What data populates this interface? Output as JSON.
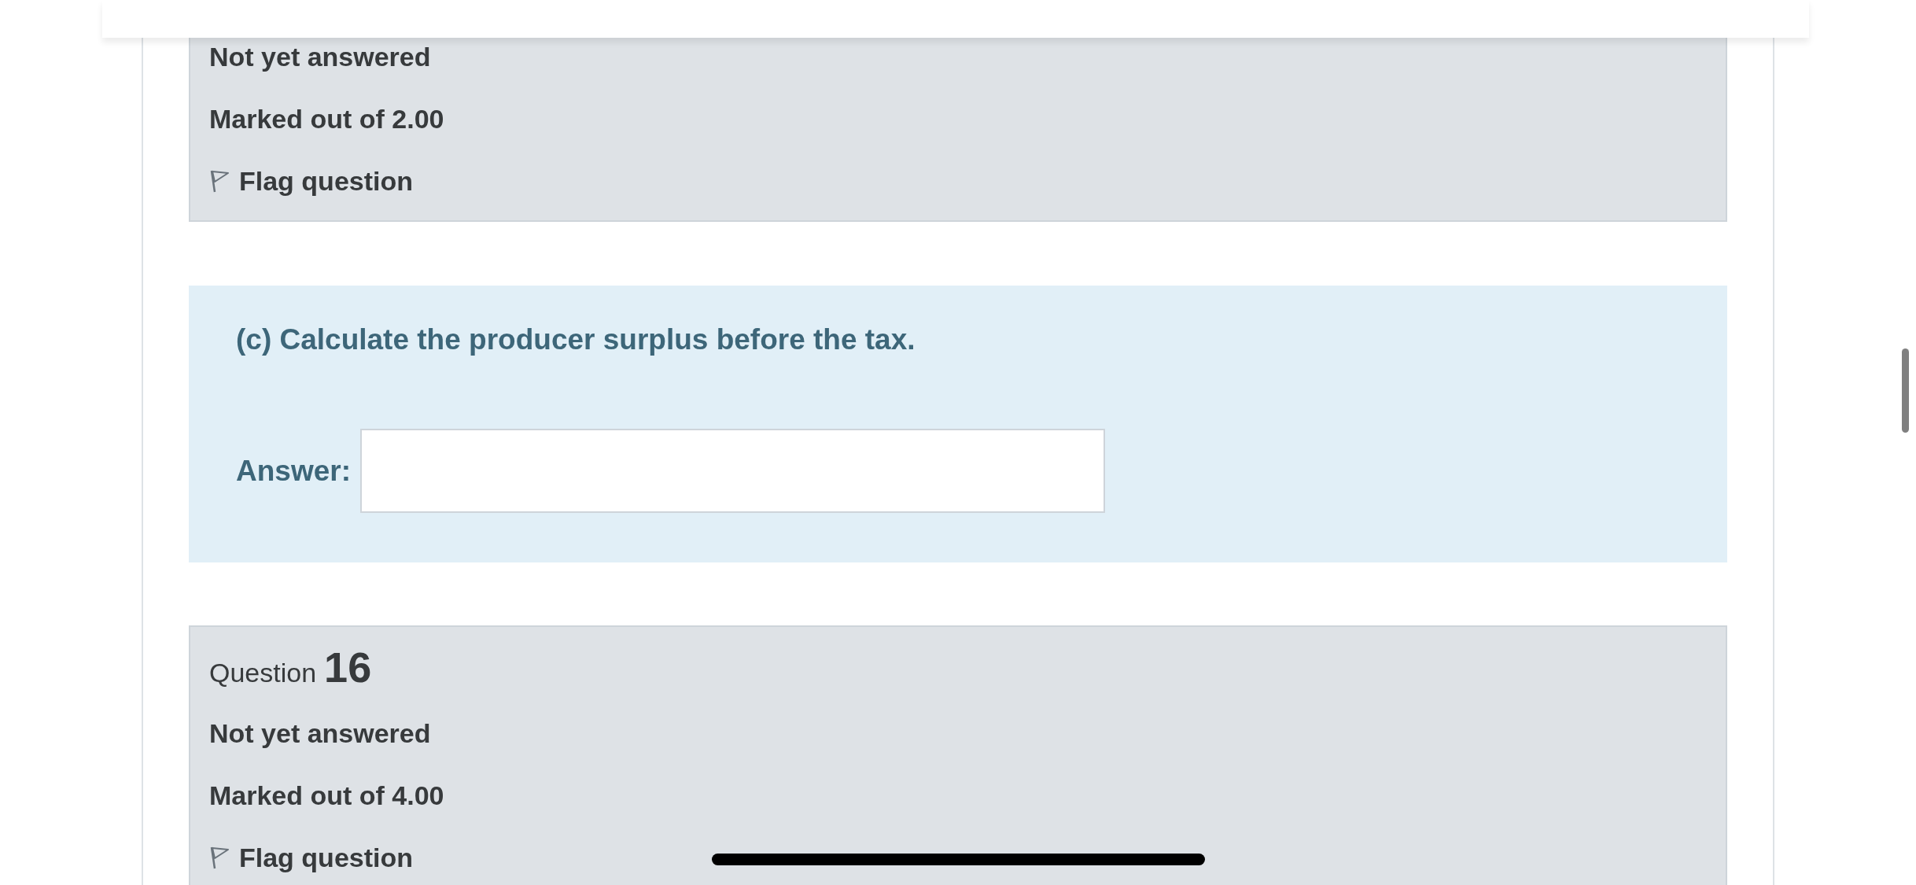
{
  "previous_question": {
    "status": "Not yet answered",
    "marks": "Marked out of 2.00",
    "flag": {
      "label": "Flag question",
      "flagged": false
    }
  },
  "question_text": {
    "prompt": "(c) Calculate the producer surplus before the tax.",
    "answer_label": "Answer:"
  },
  "next_question": {
    "label": "Question",
    "number": "16",
    "status": "Not yet answered",
    "marks": "Marked out of 4.00",
    "flag": {
      "label": "Flag question",
      "flagged": false
    }
  }
}
